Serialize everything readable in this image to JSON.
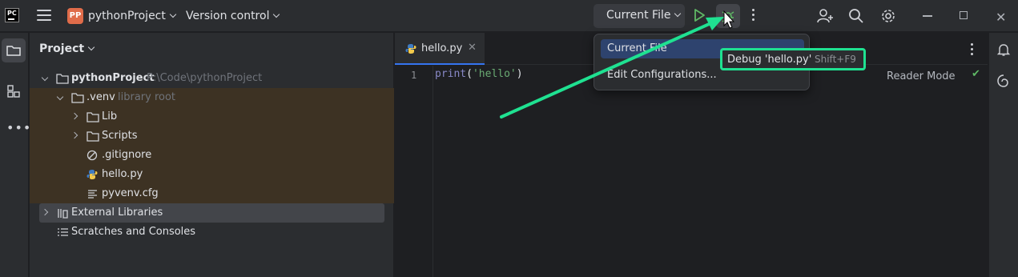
{
  "titlebar": {
    "project_badge": "PP",
    "project_name": "pythonProject",
    "version_control": "Version control",
    "run_config": "Current File"
  },
  "project_panel": {
    "title": "Project",
    "tree": [
      {
        "label": "pythonProject",
        "hint": "P:\\Code\\pythonProject",
        "icon": "folder-icon"
      },
      {
        "label": ".venv",
        "hint": "library root",
        "icon": "folder-icon"
      },
      {
        "label": "Lib",
        "icon": "folder-icon"
      },
      {
        "label": "Scripts",
        "icon": "folder-icon"
      },
      {
        "label": ".gitignore",
        "icon": "ignore-file-icon"
      },
      {
        "label": "hello.py",
        "icon": "python-file-icon"
      },
      {
        "label": "pyvenv.cfg",
        "icon": "config-file-icon"
      },
      {
        "label": "External Libraries",
        "icon": "library-icon"
      },
      {
        "label": "Scratches and Consoles",
        "icon": "scratches-icon"
      }
    ]
  },
  "editor": {
    "tab_label": "hello.py",
    "line_number": "1",
    "code": {
      "fn": "print",
      "open": "(",
      "str": "'hello'",
      "close": ")"
    },
    "reader_mode": "Reader Mode"
  },
  "dropdown": {
    "items": [
      "Current File",
      "Edit Configurations..."
    ]
  },
  "tooltip": {
    "text": "Debug 'hello.py'",
    "shortcut": "Shift+F9"
  },
  "colors": {
    "accent": "#3574f0",
    "highlight": "#1fe191",
    "excluded_bg": "#3d3223",
    "selected_bg": "#2e436e"
  }
}
